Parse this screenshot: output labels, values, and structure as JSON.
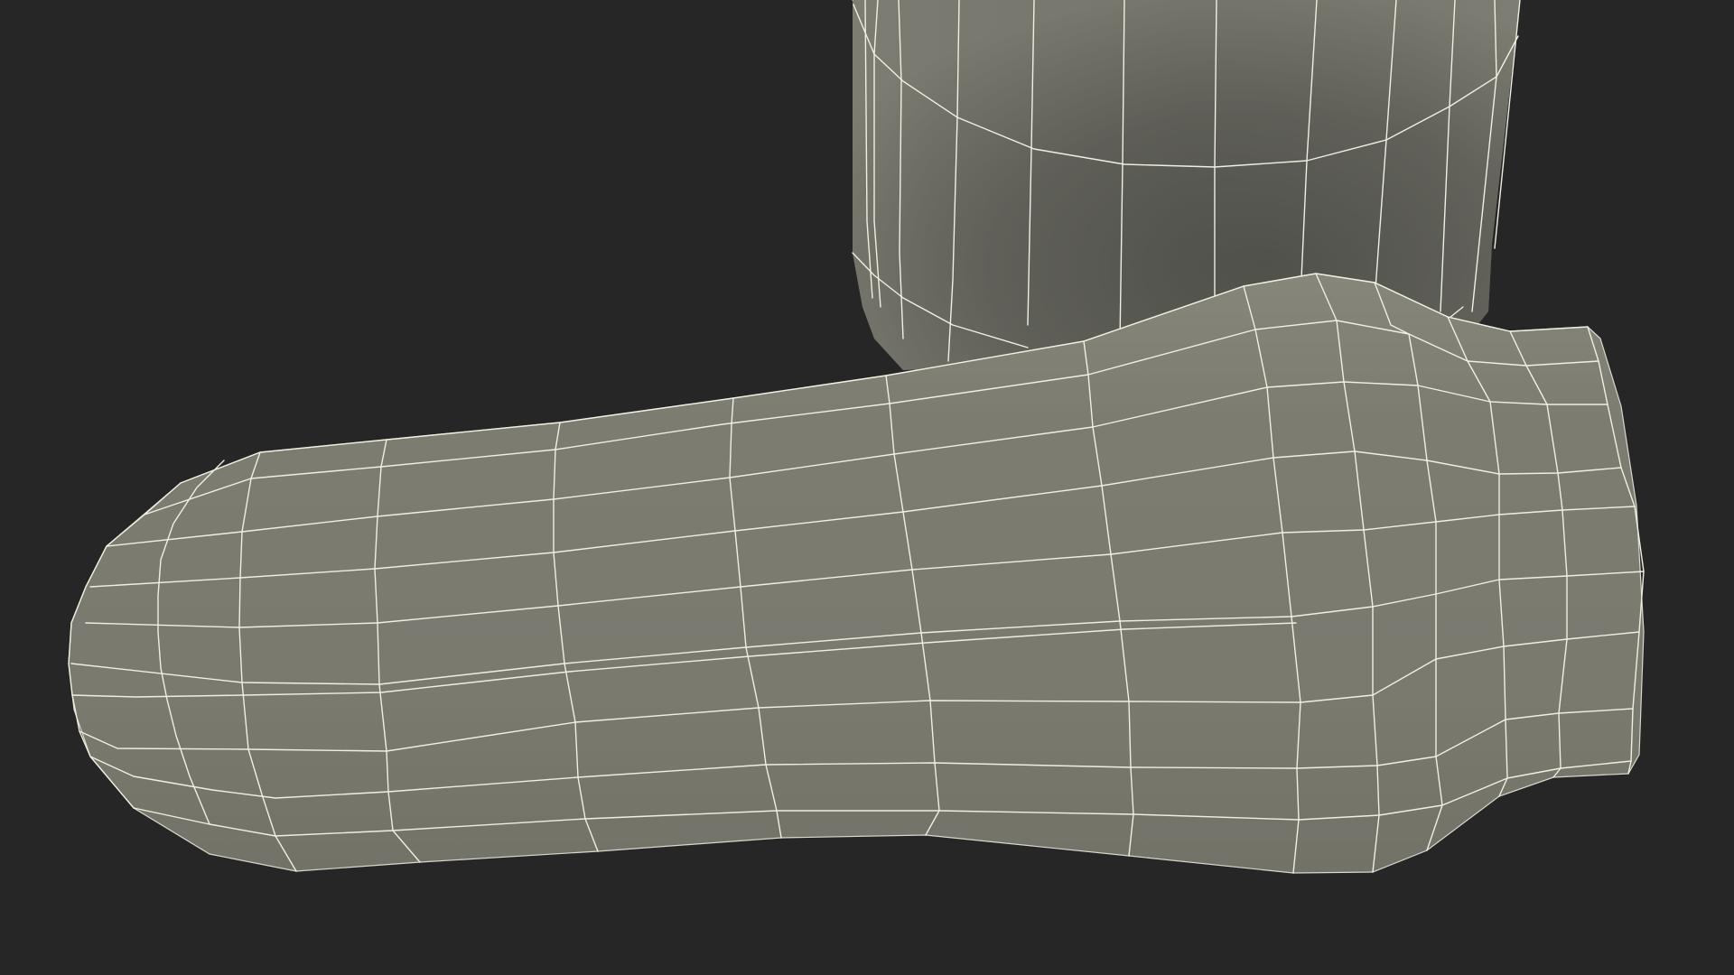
{
  "viewport": {
    "background_color": "#262626"
  },
  "scene": {
    "render_style": "wireframe-on-shaded",
    "wire_color": "#efefe2",
    "objects": [
      {
        "name": "vertical-tube",
        "base_color": "#6f6f66",
        "shadow_color": "#52524c",
        "highlight_color": "#7e7e74"
      },
      {
        "name": "horizontal-handle",
        "base_color": "#7b7b70",
        "shadow_color": "#6c6c62",
        "highlight_color": "#86867a"
      }
    ]
  }
}
